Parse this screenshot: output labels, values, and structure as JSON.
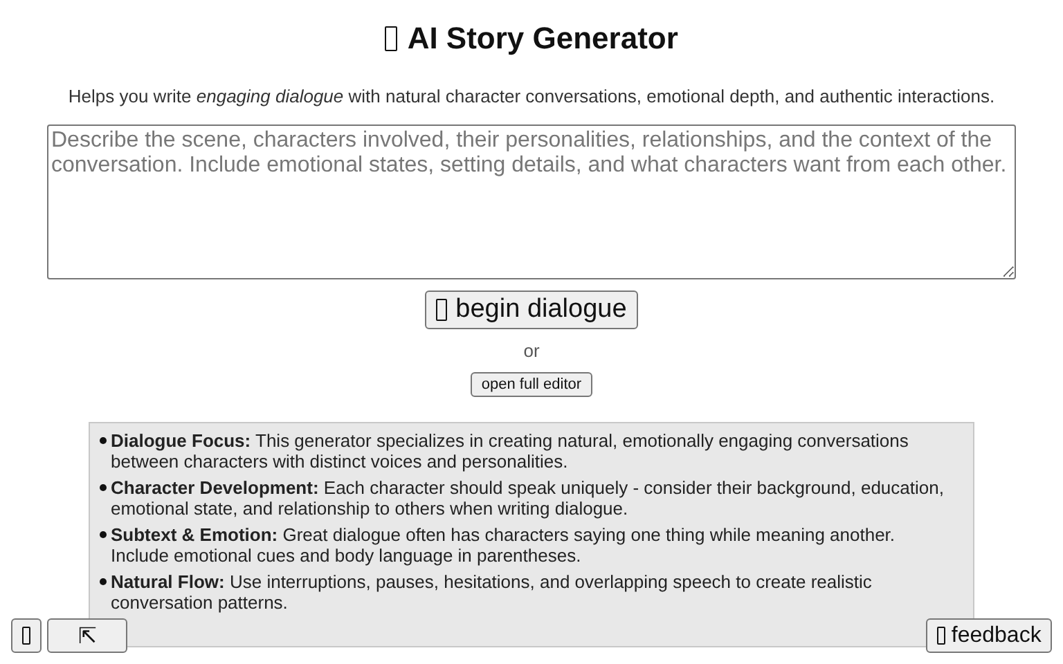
{
  "header": {
    "title": "AI Story Generator",
    "subtitle": "Helps you write *engaging dialogue* with natural character conversations, emotional depth, and authentic interactions."
  },
  "prompt": {
    "placeholder": "Describe the scene, characters involved, their personalities, relationships, and the context of the conversation. Include emotional states, setting details, and what characters want from each other."
  },
  "primary_button": "begin dialogue",
  "separator": "or",
  "secondary_button": "open full editor",
  "tips": [
    {
      "term": "Dialogue Focus:",
      "text": "This generator specializes in creating natural, emotionally engaging conversations between characters with distinct voices and personalities."
    },
    {
      "term": "Character Development:",
      "text": "Each character should speak uniquely - consider their background, education, emotional state, and relationship to others when writing dialogue."
    },
    {
      "term": "Subtext & Emotion:",
      "text": "Great dialogue often has characters saying one thing while meaning another. Include emotional cues and body language in parentheses."
    },
    {
      "term": "Natural Flow:",
      "text": "Use interruptions, pauses, hesitations, and overlapping speech to create realistic conversation patterns."
    }
  ],
  "corner_buttons": {
    "expand": "⇱",
    "feedback": "feedback"
  }
}
